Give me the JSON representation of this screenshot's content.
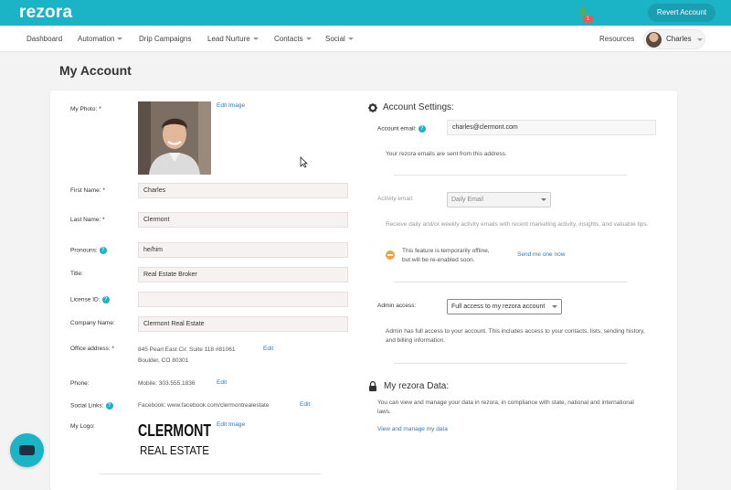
{
  "app": {
    "logo": "rezora",
    "revert_button": "Revert Account"
  },
  "nav": {
    "items": [
      {
        "label": "Dashboard",
        "dropdown": false
      },
      {
        "label": "Automation",
        "dropdown": true
      },
      {
        "label": "Drip Campaigns",
        "dropdown": false
      },
      {
        "label": "Lead Nurture",
        "dropdown": true
      },
      {
        "label": "Contacts",
        "dropdown": true
      },
      {
        "label": "Social",
        "dropdown": true
      }
    ],
    "notification_count": "1",
    "resources": "Resources",
    "user_name": "Charles"
  },
  "page": {
    "title": "My Account"
  },
  "profile": {
    "photo_label": "My Photo: *",
    "edit_image": "Edit Image",
    "first_name_label": "First Name: *",
    "first_name": "Charles",
    "last_name_label": "Last Name: *",
    "last_name": "Clermont",
    "pronouns_label": "Pronouns:",
    "pronouns": "he/him",
    "title_label": "Title:",
    "title": "Real Estate Broker",
    "license_label": "License ID:",
    "license": "",
    "company_label": "Company Name:",
    "company": "Clermont Real Estate",
    "office_label": "Office address: *",
    "office_line1": "845 Pearl East Cir. Suite 118 #81061",
    "office_line2": "Boulder, CO 80301",
    "edit": "Edit",
    "phone_label": "Phone:",
    "phone": "Mobile: 303.555.1836",
    "social_label": "Social Links:",
    "social": "Facebook: www.facebook.com/clermontrealestate",
    "logo_label": "My Logo:",
    "logo_line1": "CLERMONT",
    "logo_line2": "REAL ESTATE"
  },
  "settings": {
    "title": "Account Settings:",
    "email_label": "Account email:",
    "email": "charles@clermont.com",
    "email_note": "Your rezora emails are sent from this address.",
    "activity_label": "Activity email:",
    "activity_value": "Daily Email",
    "activity_note": "Receive daily and/or weekly activity emails with recent marketing activity, insights, and valuable tips.",
    "offline_note_1": "This feature is temporarily offline,",
    "offline_note_2": "but will be re-enabled soon.",
    "send_link": "Send me one now",
    "admin_label": "Admin access:",
    "admin_value": "Full access to my rezora account",
    "admin_note": "Admin has full access to your account. This includes access to your contacts, lists, sending history, and billing information."
  },
  "data_section": {
    "title": "My rezora Data:",
    "note": "You can view and manage your data in rezora, in compliance with state, national and international laws.",
    "link": "View and manage my data"
  },
  "colors": {
    "brand": "#1bb3c6",
    "link": "#2a7ac7",
    "warning": "#f0a040"
  }
}
